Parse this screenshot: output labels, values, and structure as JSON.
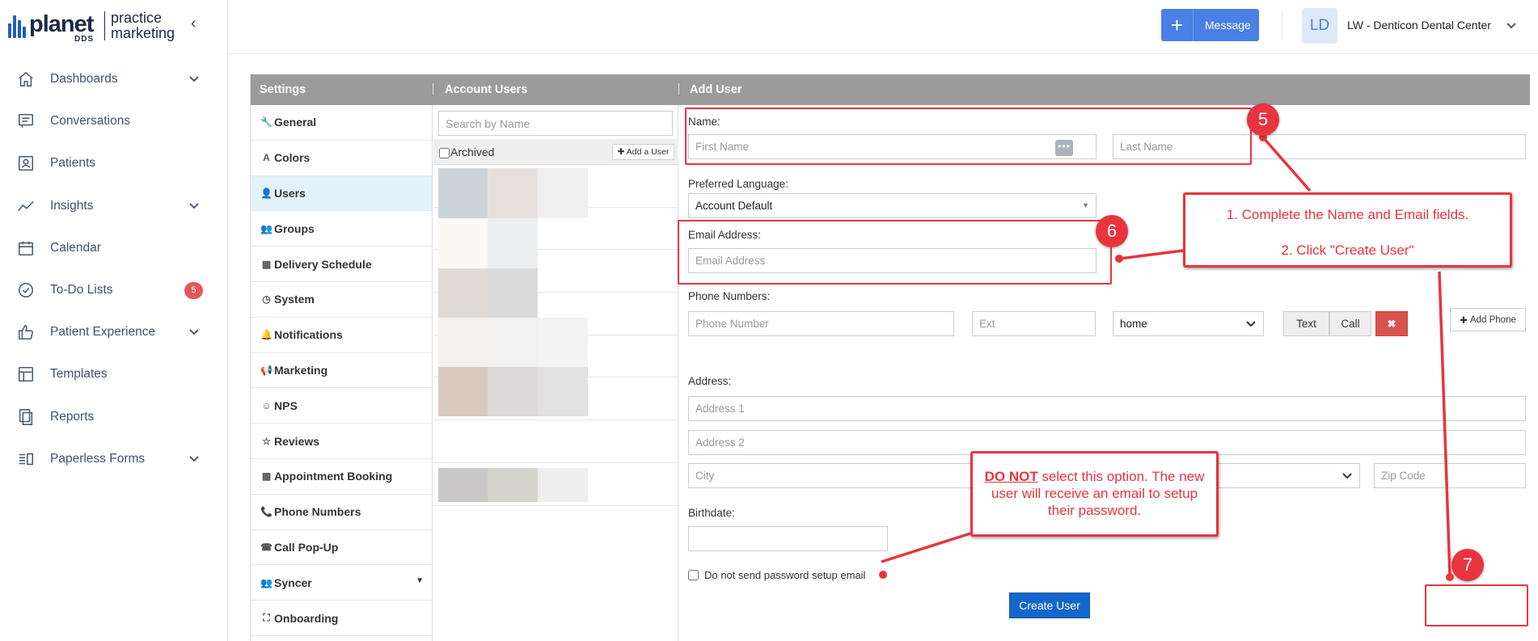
{
  "brand": {
    "name": "planet",
    "sub": "DDS",
    "product_line1": "practice",
    "product_line2": "marketing"
  },
  "sidebar": {
    "items": [
      {
        "label": "Dashboards",
        "icon": "home-icon",
        "chevron": true
      },
      {
        "label": "Conversations",
        "icon": "chat-icon",
        "chevron": false
      },
      {
        "label": "Patients",
        "icon": "patients-icon",
        "chevron": false
      },
      {
        "label": "Insights",
        "icon": "insights-icon",
        "chevron": true
      },
      {
        "label": "Calendar",
        "icon": "calendar-icon",
        "chevron": false
      },
      {
        "label": "To-Do Lists",
        "icon": "check-circle-icon",
        "badge": "5"
      },
      {
        "label": "Patient Experience",
        "icon": "thumbs-up-icon",
        "chevron": true
      },
      {
        "label": "Templates",
        "icon": "templates-icon",
        "chevron": false
      },
      {
        "label": "Reports",
        "icon": "reports-icon",
        "chevron": false
      },
      {
        "label": "Paperless Forms",
        "icon": "forms-icon",
        "chevron": true
      }
    ]
  },
  "header": {
    "message_label": "Message",
    "avatar_initials": "LD",
    "account_name": "LW - Denticon Dental Center"
  },
  "panel": {
    "col1": "Settings",
    "col2": "Account Users",
    "col3": "Add User"
  },
  "settings_menu": [
    {
      "label": "General",
      "glyph": "🔧"
    },
    {
      "label": "Colors",
      "glyph": "A"
    },
    {
      "label": "Users",
      "glyph": "👤",
      "active": true
    },
    {
      "label": "Groups",
      "glyph": "👥"
    },
    {
      "label": "Delivery Schedule",
      "glyph": "▦"
    },
    {
      "label": "System",
      "glyph": "◷"
    },
    {
      "label": "Notifications",
      "glyph": "🔔"
    },
    {
      "label": "Marketing",
      "glyph": "📢"
    },
    {
      "label": "NPS",
      "glyph": "☺"
    },
    {
      "label": "Reviews",
      "glyph": "☆"
    },
    {
      "label": "Appointment Booking",
      "glyph": "▦"
    },
    {
      "label": "Phone Numbers",
      "glyph": "📞"
    },
    {
      "label": "Call Pop-Up",
      "glyph": "☎"
    },
    {
      "label": "Syncer",
      "glyph": "👥",
      "caret": true
    },
    {
      "label": "Onboarding",
      "glyph": "⛶"
    }
  ],
  "users": {
    "search_placeholder": "Search by Name",
    "archived_label": "Archived",
    "add_user_label": "Add a User"
  },
  "form": {
    "name_label": "Name:",
    "first_name_placeholder": "First Name",
    "last_name_placeholder": "Last Name",
    "language_label": "Preferred Language:",
    "language_value": "Account Default",
    "email_label": "Email Address:",
    "email_placeholder": "Email Address",
    "phone_label": "Phone Numbers:",
    "phone_placeholder": "Phone Number",
    "ext_placeholder": "Ext",
    "phone_type": "home",
    "text_label": "Text",
    "call_label": "Call",
    "add_phone_label": "Add Phone",
    "address_label": "Address:",
    "address1_placeholder": "Address 1",
    "address2_placeholder": "Address 2",
    "city_placeholder": "City",
    "zip_placeholder": "Zip Code",
    "birthdate_label": "Birthdate:",
    "no_password_email_label": "Do not send password setup email",
    "create_label": "Create User"
  },
  "annotations": {
    "step5": "5",
    "step6": "6",
    "step7": "7",
    "callout_instructions_line1": "1. Complete the Name and Email fields.",
    "callout_instructions_line2": "2. Click \"Create User\"",
    "callout_warning_strong": "DO NOT",
    "callout_warning_rest": " select this option. The new user will receive an email to setup their password.",
    "color": "#e8343e"
  }
}
